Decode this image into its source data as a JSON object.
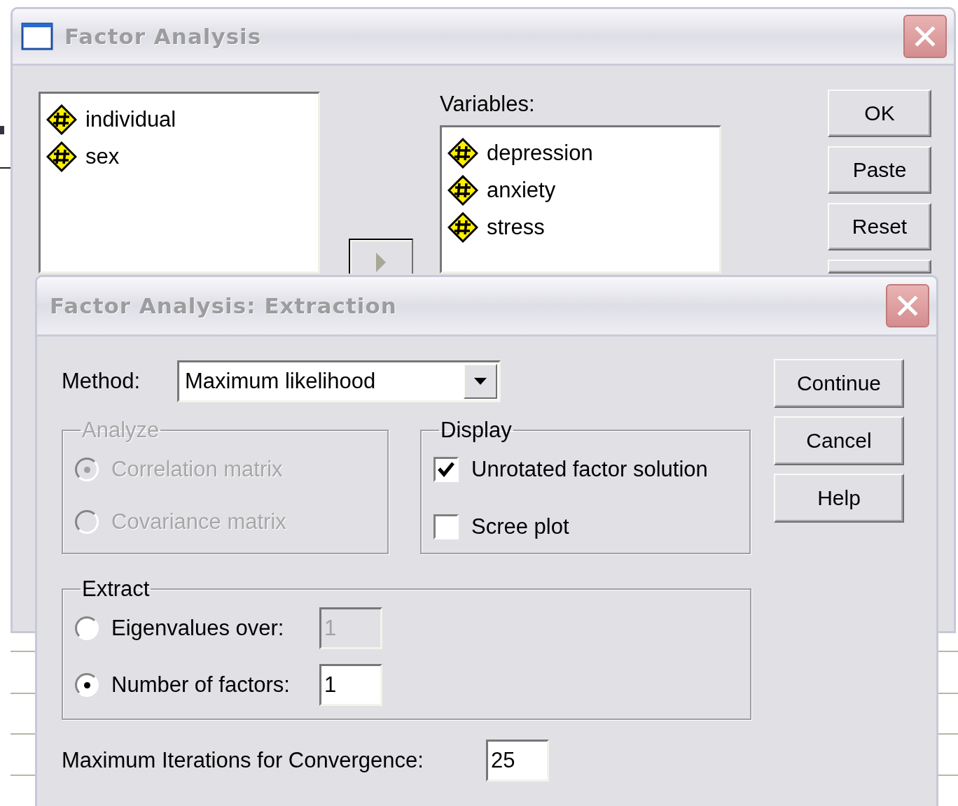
{
  "main_dialog": {
    "title": "Factor Analysis",
    "source_variables": [
      {
        "name": "individual"
      },
      {
        "name": "sex"
      }
    ],
    "variables_label": "Variables:",
    "variables": [
      {
        "name": "depression"
      },
      {
        "name": "anxiety"
      },
      {
        "name": "stress"
      }
    ],
    "buttons": [
      "OK",
      "Paste",
      "Reset"
    ]
  },
  "extraction_dialog": {
    "title": "Factor Analysis: Extraction",
    "method_label": "Method:",
    "method": "Maximum likelihood",
    "analyze": {
      "title": "Analyze",
      "disabled": true,
      "options": [
        {
          "kind": "radio",
          "label": "Correlation matrix",
          "selected": true
        },
        {
          "kind": "radio",
          "label": "Covariance matrix",
          "selected": false
        }
      ]
    },
    "display": {
      "title": "Display",
      "disabled": false,
      "options": [
        {
          "kind": "checkbox",
          "label": "Unrotated factor solution",
          "checked": true
        },
        {
          "kind": "checkbox",
          "label": "Scree plot",
          "checked": false
        }
      ]
    },
    "extract": {
      "title": "Extract",
      "disabled": false,
      "options": [
        {
          "kind": "radio",
          "label": "Eigenvalues over:",
          "selected": false,
          "value": "1"
        },
        {
          "kind": "radio",
          "label": "Number of factors:",
          "selected": true,
          "value": "1"
        }
      ]
    },
    "iterations_label": "Maximum Iterations for Convergence:",
    "iterations": "25",
    "buttons": [
      "Continue",
      "Cancel",
      "Help"
    ]
  }
}
